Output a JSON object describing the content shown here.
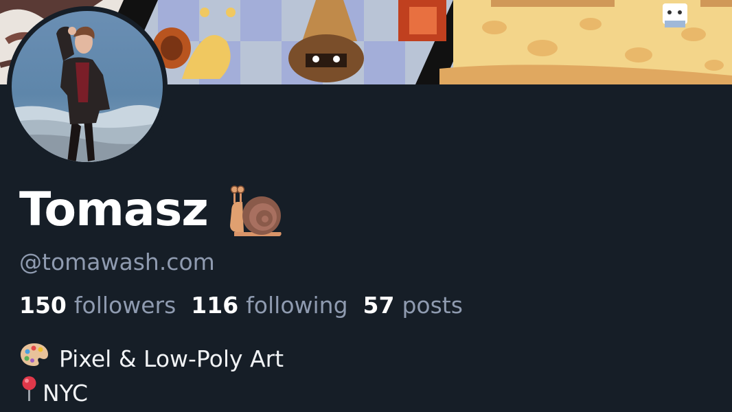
{
  "profile": {
    "display_name": "Tomasz",
    "name_emoji": "snail-emoji",
    "handle": "@tomawash.com",
    "stats": [
      {
        "count": "150",
        "label": "followers"
      },
      {
        "count": "116",
        "label": "following"
      },
      {
        "count": "57",
        "label": "posts"
      }
    ],
    "bio": [
      {
        "icon": "artist-palette-emoji",
        "text": "Pixel & Low-Poly Art"
      },
      {
        "icon": "round-pushpin-emoji",
        "text": "NYC"
      }
    ]
  },
  "colors": {
    "background": "#161e27",
    "name_text": "#ffffff",
    "muted_text": "#8f9bb0"
  }
}
